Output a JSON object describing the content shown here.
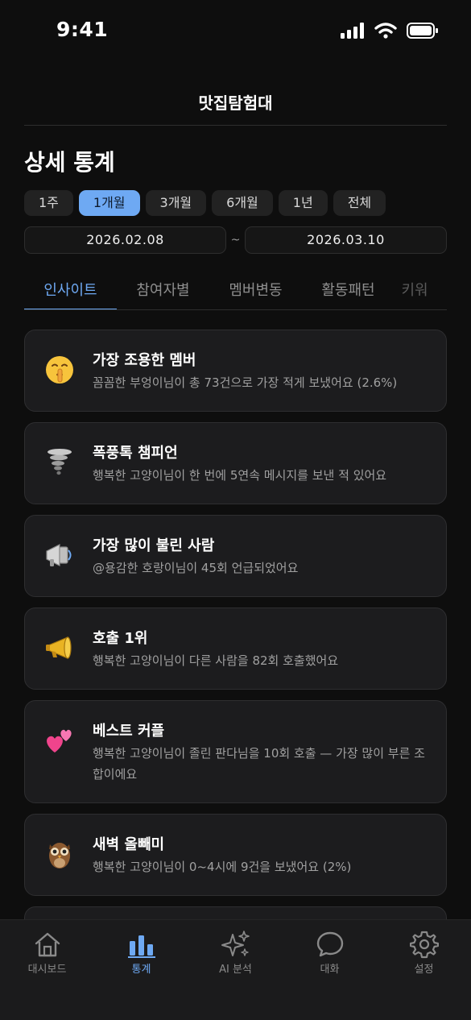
{
  "status": {
    "time": "9:41"
  },
  "header": {
    "title": "맛집탐험대"
  },
  "page": {
    "title": "상세 통계"
  },
  "periods": [
    {
      "label": "1주",
      "active": false
    },
    {
      "label": "1개월",
      "active": true
    },
    {
      "label": "3개월",
      "active": false
    },
    {
      "label": "6개월",
      "active": false
    },
    {
      "label": "1년",
      "active": false
    },
    {
      "label": "전체",
      "active": false
    }
  ],
  "date_range": {
    "start": "2026.02.08",
    "separator": "~",
    "end": "2026.03.10"
  },
  "tabs": [
    {
      "label": "인사이트",
      "active": true
    },
    {
      "label": "참여자별",
      "active": false
    },
    {
      "label": "멤버변동",
      "active": false
    },
    {
      "label": "활동패턴",
      "active": false
    },
    {
      "label": "키워",
      "active": false
    }
  ],
  "insights": [
    {
      "icon": "shushing-face-icon",
      "title": "가장 조용한 멤버",
      "desc": "꼼꼼한 부엉이님이 총 73건으로 가장 적게 보냈어요 (2.6%)"
    },
    {
      "icon": "tornado-icon",
      "title": "폭풍톡 챔피언",
      "desc": "행복한 고양이님이 한 번에 5연속 메시지를 보낸 적 있어요"
    },
    {
      "icon": "loudspeaker-icon",
      "title": "가장 많이 불린 사람",
      "desc": "@용감한 호랑이님이 45회 언급되었어요"
    },
    {
      "icon": "megaphone-icon",
      "title": "호출 1위",
      "desc": "행복한 고양이님이 다른 사람을 82회 호출했어요"
    },
    {
      "icon": "two-hearts-icon",
      "title": "베스트 커플",
      "desc": "행복한 고양이님이 졸린 판다님을 10회 호출 — 가장 많이 부른 조합이에요"
    },
    {
      "icon": "owl-icon",
      "title": "새벽 올빼미",
      "desc": "행복한 고양이님이 0~4시에 9건을 보냈어요 (2%)"
    }
  ],
  "nav": [
    {
      "icon": "home-icon",
      "label": "대시보드",
      "active": false
    },
    {
      "icon": "bar-chart-icon",
      "label": "통계",
      "active": true
    },
    {
      "icon": "sparkles-icon",
      "label": "AI 분석",
      "active": false
    },
    {
      "icon": "chat-bubble-icon",
      "label": "대화",
      "active": false
    },
    {
      "icon": "gear-icon",
      "label": "설정",
      "active": false
    }
  ],
  "colors": {
    "accent": "#6ea9f3",
    "background": "#0e0e0e",
    "card": "#1c1c1e"
  }
}
